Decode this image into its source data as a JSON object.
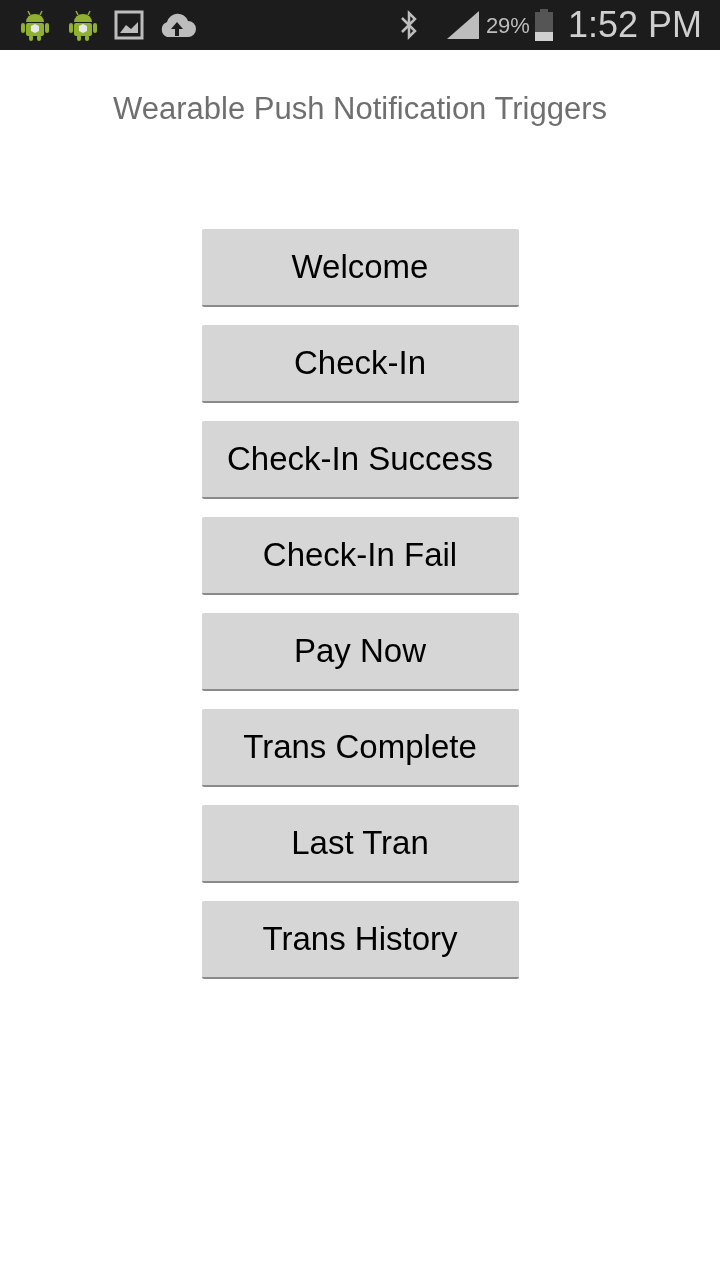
{
  "status_bar": {
    "battery_percent": "29%",
    "time": "1:52 PM"
  },
  "title": "Wearable Push Notification Triggers",
  "buttons": [
    "Welcome",
    "Check-In",
    "Check-In Success",
    "Check-In Fail",
    "Pay Now",
    "Trans Complete",
    "Last Tran",
    "Trans History"
  ]
}
